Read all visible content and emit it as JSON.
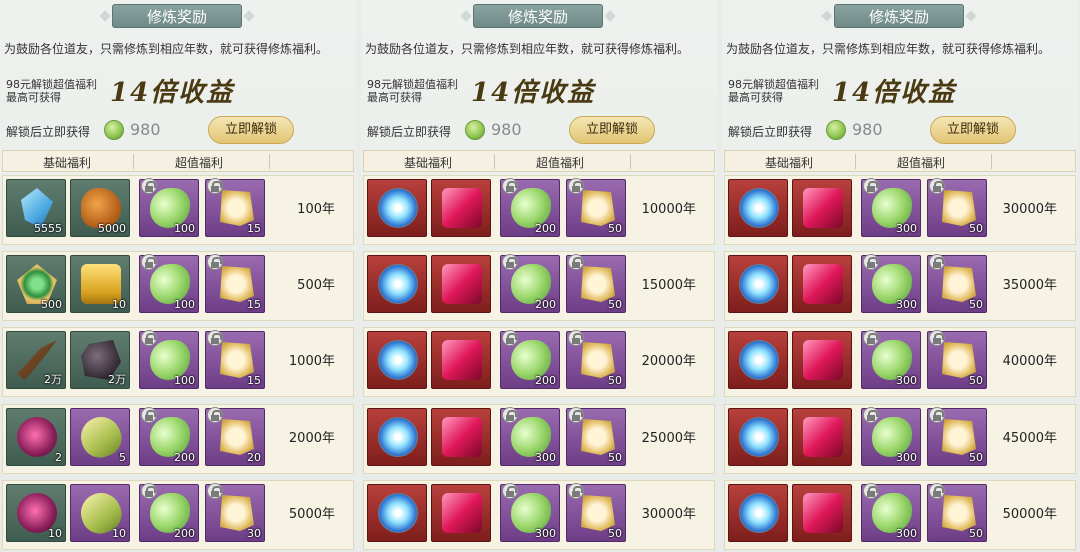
{
  "panels": [
    {
      "title": "修炼奖励",
      "description": "为鼓励各位道友，只需修炼到相应年数，就可获得修炼福利。",
      "unlock_price_line1": "98元解锁超值福利",
      "unlock_price_line2": "最高可获得",
      "multiplier": "14倍收益",
      "gain_label": "解锁后立即获得",
      "coin_amount": "980",
      "unlock_button": "立即解锁",
      "header_basic": "基础福利",
      "header_premium": "超值福利",
      "rows": [
        {
          "items": [
            {
              "icon": "crystal",
              "qty": "5555"
            },
            {
              "icon": "beast",
              "qty": "5000"
            },
            {
              "icon": "jade",
              "qty": "100"
            },
            {
              "icon": "scroll",
              "qty": "15"
            }
          ],
          "year": "100年"
        },
        {
          "items": [
            {
              "icon": "crest",
              "qty": "500"
            },
            {
              "icon": "chest",
              "qty": "10"
            },
            {
              "icon": "jade",
              "qty": "100"
            },
            {
              "icon": "scroll",
              "qty": "15"
            }
          ],
          "year": "500年"
        },
        {
          "items": [
            {
              "icon": "branch",
              "qty": "2万"
            },
            {
              "icon": "ore",
              "qty": "2万"
            },
            {
              "icon": "jade",
              "qty": "100"
            },
            {
              "icon": "scroll",
              "qty": "15"
            }
          ],
          "year": "1000年"
        },
        {
          "items": [
            {
              "icon": "fruit",
              "qty": "2"
            },
            {
              "icon": "cocoon",
              "qty": "5"
            },
            {
              "icon": "jade",
              "qty": "200"
            },
            {
              "icon": "scroll",
              "qty": "20"
            }
          ],
          "year": "2000年"
        },
        {
          "items": [
            {
              "icon": "fruit",
              "qty": "10"
            },
            {
              "icon": "cocoon",
              "qty": "10"
            },
            {
              "icon": "jade",
              "qty": "200"
            },
            {
              "icon": "scroll",
              "qty": "30"
            }
          ],
          "year": "5000年"
        }
      ]
    },
    {
      "title": "修炼奖励",
      "description": "为鼓励各位道友，只需修炼到相应年数，就可获得修炼福利。",
      "unlock_price_line1": "98元解锁超值福利",
      "unlock_price_line2": "最高可获得",
      "multiplier": "14倍收益",
      "gain_label": "解锁后立即获得",
      "coin_amount": "980",
      "unlock_button": "立即解锁",
      "header_basic": "基础福利",
      "header_premium": "超值福利",
      "rows": [
        {
          "items": [
            {
              "icon": "orb",
              "qty": ""
            },
            {
              "icon": "gem",
              "qty": ""
            },
            {
              "icon": "jade",
              "qty": "200"
            },
            {
              "icon": "scroll",
              "qty": "50"
            }
          ],
          "year": "10000年"
        },
        {
          "items": [
            {
              "icon": "orb",
              "qty": ""
            },
            {
              "icon": "gem",
              "qty": ""
            },
            {
              "icon": "jade",
              "qty": "200"
            },
            {
              "icon": "scroll",
              "qty": "50"
            }
          ],
          "year": "15000年"
        },
        {
          "items": [
            {
              "icon": "orb",
              "qty": ""
            },
            {
              "icon": "gem",
              "qty": ""
            },
            {
              "icon": "jade",
              "qty": "200"
            },
            {
              "icon": "scroll",
              "qty": "50"
            }
          ],
          "year": "20000年"
        },
        {
          "items": [
            {
              "icon": "orb",
              "qty": ""
            },
            {
              "icon": "gem",
              "qty": ""
            },
            {
              "icon": "jade",
              "qty": "300"
            },
            {
              "icon": "scroll",
              "qty": "50"
            }
          ],
          "year": "25000年"
        },
        {
          "items": [
            {
              "icon": "orb",
              "qty": ""
            },
            {
              "icon": "gem",
              "qty": ""
            },
            {
              "icon": "jade",
              "qty": "300"
            },
            {
              "icon": "scroll",
              "qty": "50"
            }
          ],
          "year": "30000年"
        }
      ]
    },
    {
      "title": "修炼奖励",
      "description": "为鼓励各位道友，只需修炼到相应年数，就可获得修炼福利。",
      "unlock_price_line1": "98元解锁超值福利",
      "unlock_price_line2": "最高可获得",
      "multiplier": "14倍收益",
      "gain_label": "解锁后立即获得",
      "coin_amount": "980",
      "unlock_button": "立即解锁",
      "header_basic": "基础福利",
      "header_premium": "超值福利",
      "rows": [
        {
          "items": [
            {
              "icon": "orb",
              "qty": ""
            },
            {
              "icon": "gem",
              "qty": ""
            },
            {
              "icon": "jade",
              "qty": "300"
            },
            {
              "icon": "scroll",
              "qty": "50"
            }
          ],
          "year": "30000年"
        },
        {
          "items": [
            {
              "icon": "orb",
              "qty": ""
            },
            {
              "icon": "gem",
              "qty": ""
            },
            {
              "icon": "jade",
              "qty": "300"
            },
            {
              "icon": "scroll",
              "qty": "50"
            }
          ],
          "year": "35000年"
        },
        {
          "items": [
            {
              "icon": "orb",
              "qty": ""
            },
            {
              "icon": "gem",
              "qty": ""
            },
            {
              "icon": "jade",
              "qty": "300"
            },
            {
              "icon": "scroll",
              "qty": "50"
            }
          ],
          "year": "40000年"
        },
        {
          "items": [
            {
              "icon": "orb",
              "qty": ""
            },
            {
              "icon": "gem",
              "qty": ""
            },
            {
              "icon": "jade",
              "qty": "300"
            },
            {
              "icon": "scroll",
              "qty": "50"
            }
          ],
          "year": "45000年"
        },
        {
          "items": [
            {
              "icon": "orb",
              "qty": ""
            },
            {
              "icon": "gem",
              "qty": ""
            },
            {
              "icon": "jade",
              "qty": "300"
            },
            {
              "icon": "scroll",
              "qty": "50"
            }
          ],
          "year": "50000年"
        }
      ]
    }
  ]
}
